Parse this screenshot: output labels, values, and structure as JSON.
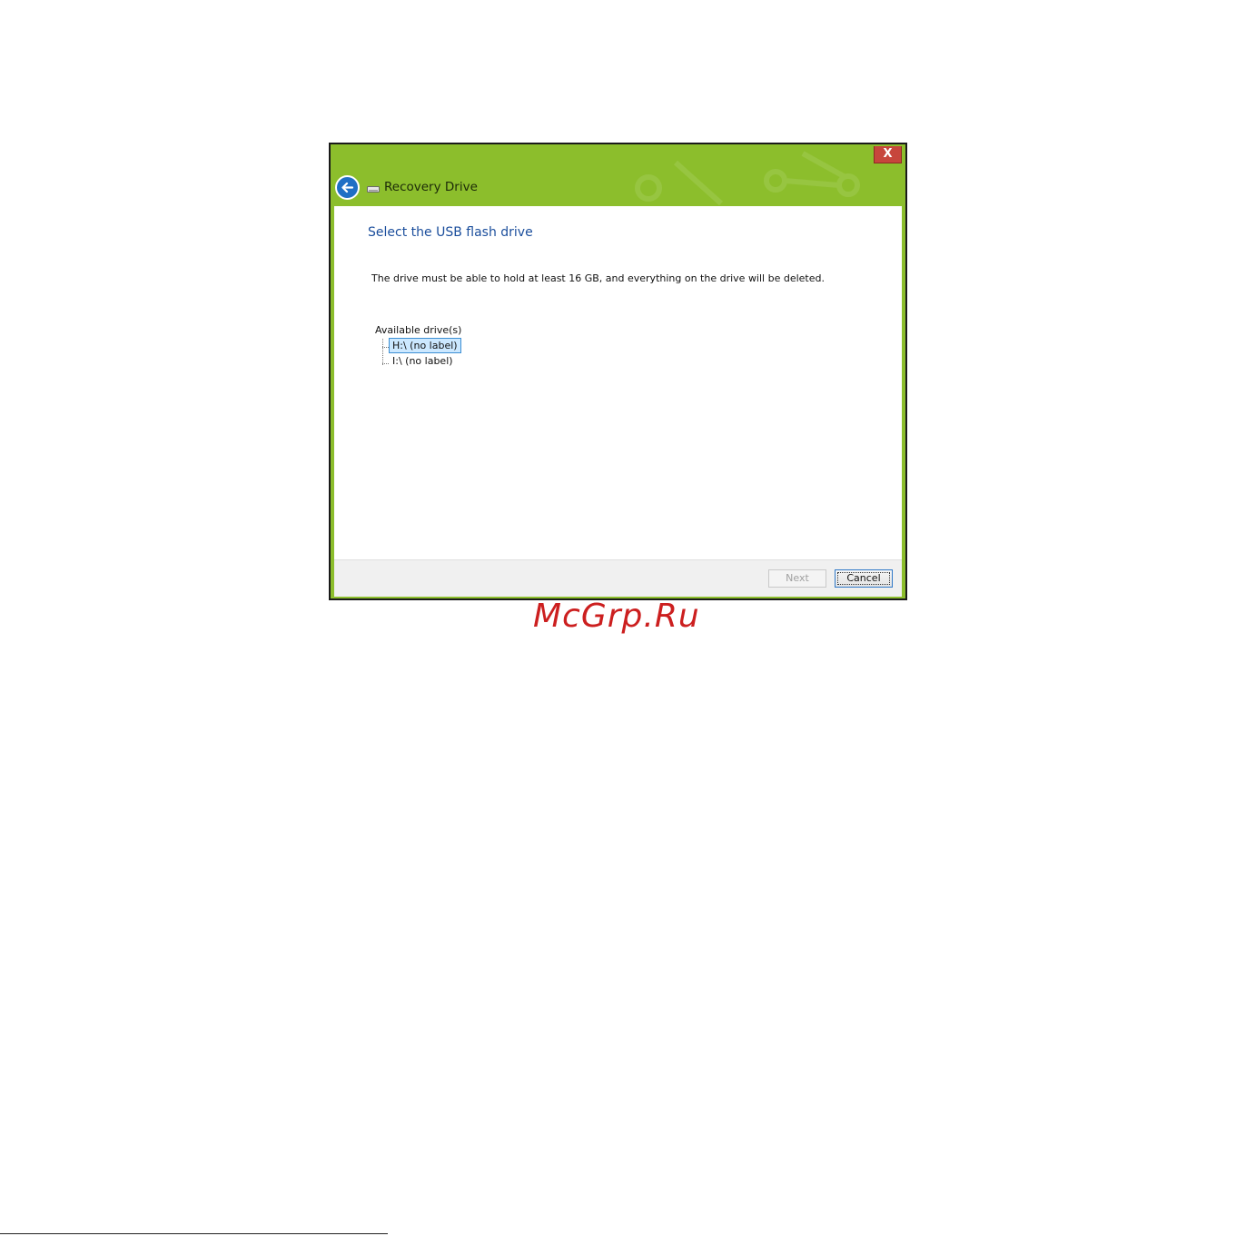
{
  "window": {
    "title": "Recovery Drive",
    "close_label": "X",
    "accent_color": "#8cbe2c",
    "back_icon": "back-arrow-icon",
    "title_icon": "drive-icon"
  },
  "content": {
    "heading": "Select the USB flash drive",
    "description": "The drive must be able to hold at least 16 GB, and everything on the drive will be deleted.",
    "drives_label": "Available drive(s)",
    "drives": [
      {
        "label": "H:\\ (no label)",
        "selected": true
      },
      {
        "label": "I:\\ (no label)",
        "selected": false
      }
    ]
  },
  "footer": {
    "next_label": "Next",
    "cancel_label": "Cancel"
  },
  "watermark": "McGrp.Ru"
}
